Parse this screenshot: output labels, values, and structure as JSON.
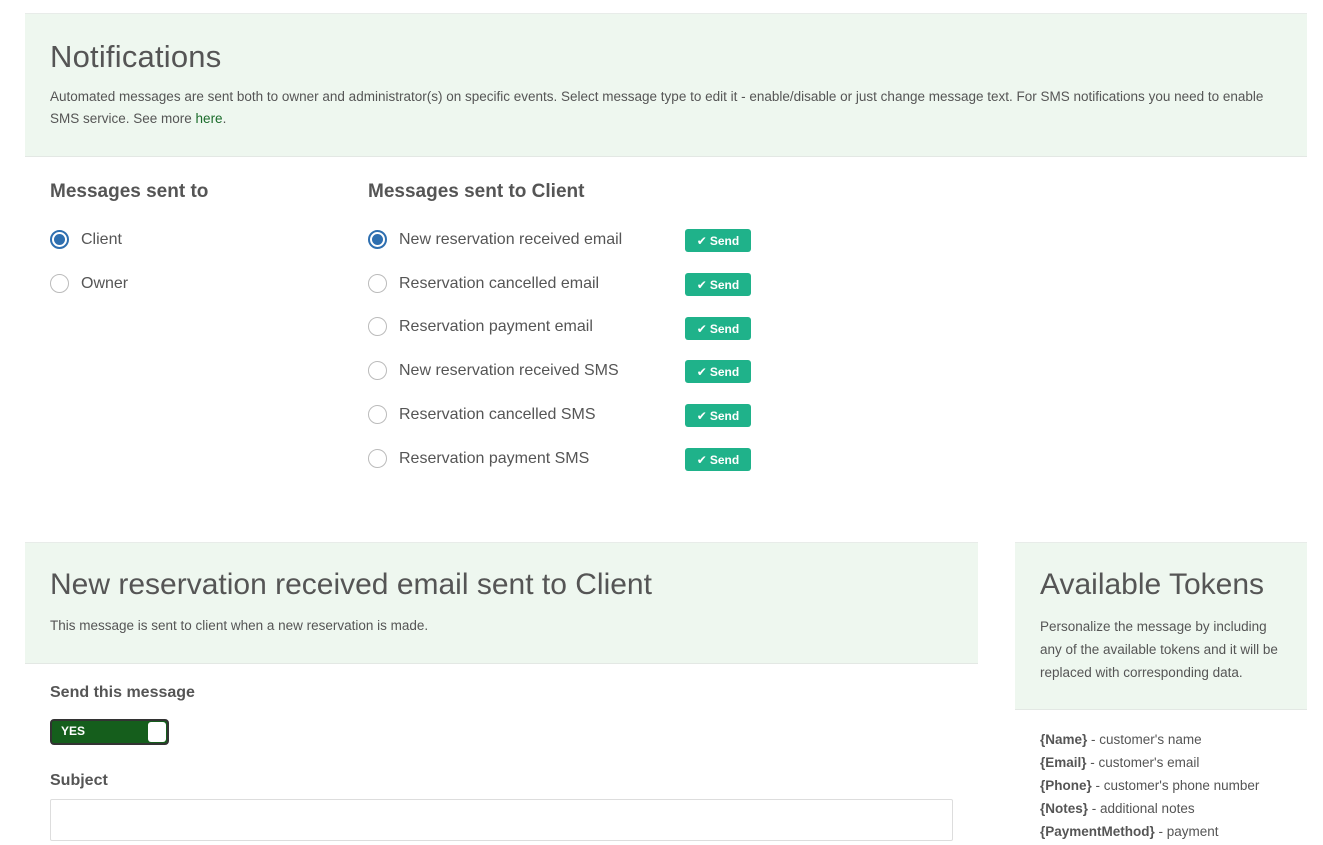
{
  "header": {
    "title": "Notifications",
    "description": "Automated messages are sent both to owner and administrator(s) on specific events. Select message type to edit it - enable/disable or just change message text. For SMS notifications you need to enable SMS service. See more ",
    "link_text": "here",
    "after_link": "."
  },
  "recipients": {
    "heading": "Messages sent to",
    "options": [
      {
        "label": "Client",
        "selected": true
      },
      {
        "label": "Owner",
        "selected": false
      }
    ]
  },
  "messages": {
    "heading": "Messages sent to Client",
    "items": [
      {
        "label": "New reservation received email",
        "selected": true,
        "badge": "Send"
      },
      {
        "label": "Reservation cancelled email",
        "selected": false,
        "badge": "Send"
      },
      {
        "label": "Reservation payment email",
        "selected": false,
        "badge": "Send"
      },
      {
        "label": "New reservation received SMS",
        "selected": false,
        "badge": "Send"
      },
      {
        "label": "Reservation cancelled SMS",
        "selected": false,
        "badge": "Send"
      },
      {
        "label": "Reservation payment SMS",
        "selected": false,
        "badge": "Send"
      }
    ]
  },
  "editor": {
    "title": "New reservation received email sent to Client",
    "description": "This message is sent to client when a new reservation is made.",
    "send_label": "Send this message",
    "toggle_value": "YES",
    "subject_label": "Subject",
    "subject_value": ""
  },
  "tokens": {
    "title": "Available Tokens",
    "description": "Personalize the message by including any of the available tokens and it will be replaced with corresponding data.",
    "items": [
      {
        "token": "{Name}",
        "desc": " - customer's name"
      },
      {
        "token": "{Email}",
        "desc": " - customer's email"
      },
      {
        "token": "{Phone}",
        "desc": " - customer's phone number"
      },
      {
        "token": "{Notes}",
        "desc": " - additional notes"
      },
      {
        "token": "{PaymentMethod}",
        "desc": " - payment"
      }
    ]
  },
  "colors": {
    "panel_bg": "#eef7ef",
    "radio_selected": "#2e6fb0",
    "badge_bg": "#1fb28a",
    "toggle_bg": "#155e1c",
    "link": "#1a6b2a"
  }
}
